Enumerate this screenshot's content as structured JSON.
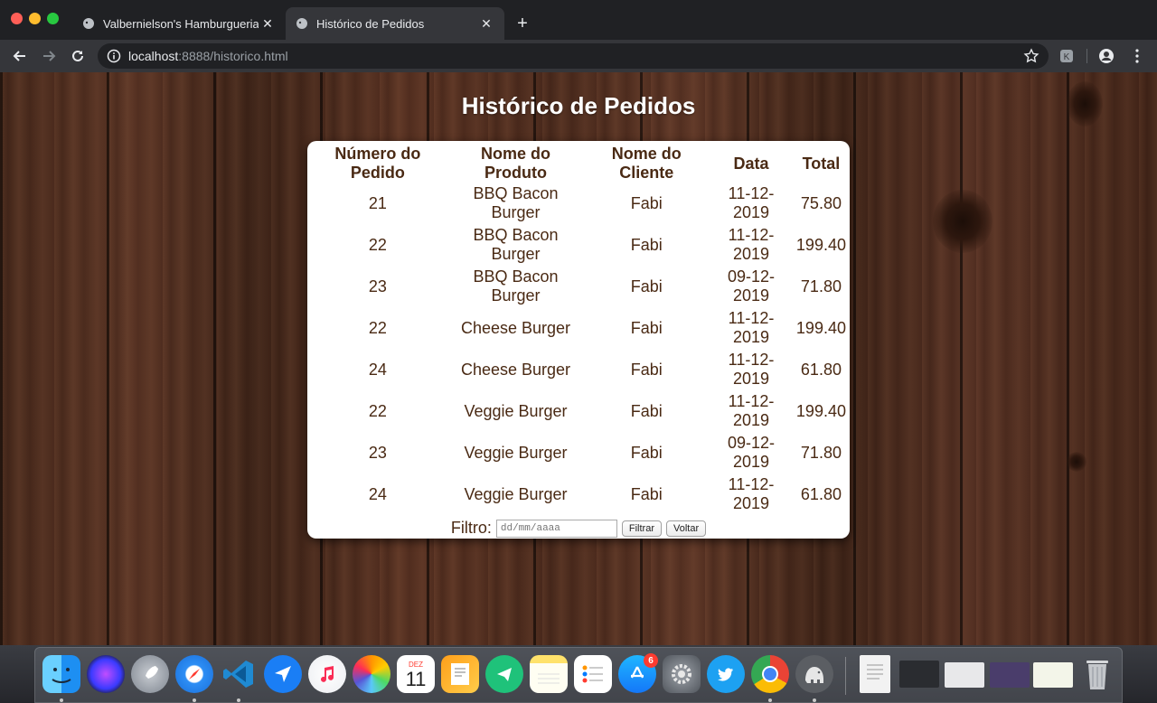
{
  "browser": {
    "tabs": [
      {
        "title": "Valbernielson's Hamburgueria",
        "active": false
      },
      {
        "title": "Histórico de Pedidos",
        "active": true
      }
    ],
    "url_host": "localhost",
    "url_rest": ":8888/historico.html"
  },
  "page": {
    "title": "Histórico de Pedidos",
    "table": {
      "headers": [
        "Número do Pedido",
        "Nome do Produto",
        "Nome do Cliente",
        "Data",
        "Total"
      ],
      "rows": [
        [
          "21",
          "BBQ Bacon Burger",
          "Fabi",
          "11-12-2019",
          "75.80"
        ],
        [
          "22",
          "BBQ Bacon Burger",
          "Fabi",
          "11-12-2019",
          "199.40"
        ],
        [
          "23",
          "BBQ Bacon Burger",
          "Fabi",
          "09-12-2019",
          "71.80"
        ],
        [
          "22",
          "Cheese Burger",
          "Fabi",
          "11-12-2019",
          "199.40"
        ],
        [
          "24",
          "Cheese Burger",
          "Fabi",
          "11-12-2019",
          "61.80"
        ],
        [
          "22",
          "Veggie Burger",
          "Fabi",
          "11-12-2019",
          "199.40"
        ],
        [
          "23",
          "Veggie Burger",
          "Fabi",
          "09-12-2019",
          "71.80"
        ],
        [
          "24",
          "Veggie Burger",
          "Fabi",
          "11-12-2019",
          "61.80"
        ]
      ]
    },
    "filter": {
      "label": "Filtro:",
      "placeholder": "dd/mm/aaaa",
      "filter_button": "Filtrar",
      "back_button": "Voltar"
    }
  },
  "dock": {
    "calendar_month": "DEZ",
    "calendar_day": "11",
    "appstore_badge": "6",
    "apps": [
      "finder-icon",
      "siri-icon",
      "launchpad-icon",
      "safari-icon",
      "vscode-icon",
      "spark-icon",
      "music-icon",
      "photos-icon",
      "calendar-icon",
      "pages-icon",
      "telegram-icon",
      "notes-icon",
      "reminders-icon",
      "app-store-icon",
      "system-preferences-icon",
      "twitter-icon",
      "chrome-icon",
      "mamp-icon"
    ]
  }
}
